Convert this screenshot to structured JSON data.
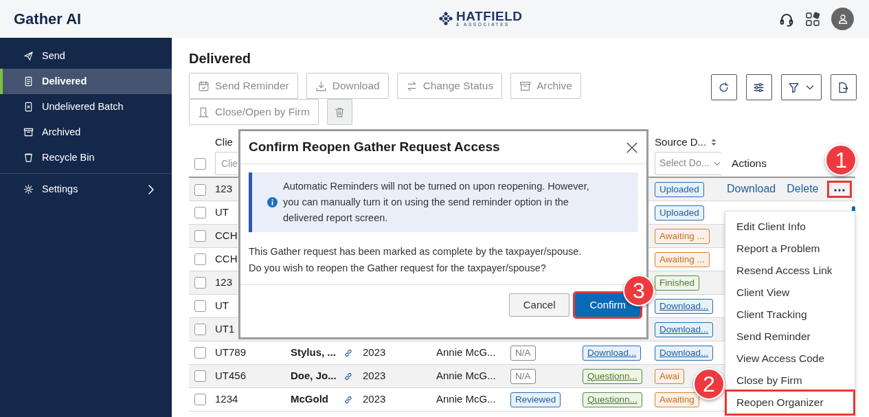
{
  "app": {
    "name": "Gather AI"
  },
  "brand": {
    "name": "HATFIELD",
    "tagline": "& ASSOCIATES"
  },
  "sidebar": {
    "items": [
      {
        "label": "Send",
        "selected": false
      },
      {
        "label": "Delivered",
        "selected": true
      },
      {
        "label": "Undelivered Batch",
        "selected": false
      },
      {
        "label": "Archived",
        "selected": false
      },
      {
        "label": "Recycle Bin",
        "selected": false
      }
    ],
    "settings": {
      "label": "Settings"
    }
  },
  "page": {
    "title": "Delivered"
  },
  "toolbar": {
    "buttons": [
      {
        "label": "Send Reminder",
        "disabled": true
      },
      {
        "label": "Download",
        "disabled": true
      },
      {
        "label": "Change Status",
        "disabled": true
      },
      {
        "label": "Archive",
        "disabled": true
      },
      {
        "label": "Close/Open by Firm",
        "disabled": true
      },
      {
        "disabled": true
      }
    ]
  },
  "table": {
    "select_all": {
      "checked": false
    },
    "header": {
      "column_1": {
        "label": "Clie",
        "filter_placeholder": "Clie"
      },
      "column_8": {
        "label": "Source D...",
        "filter_placeholder": "Select Do..."
      },
      "actions": {
        "label": "Actions"
      }
    },
    "rows": [
      {
        "checked": false,
        "column_1": "123",
        "column_8": {
          "text": "Uploaded",
          "kind": "uploaded"
        },
        "actions": {
          "links": [
            "Download",
            "Delete"
          ],
          "more": {
            "highlighted": true,
            "callout": "1"
          }
        }
      },
      {
        "checked": false,
        "column_1": "UT",
        "column_8": {
          "text": "Uploaded",
          "kind": "uploaded"
        }
      },
      {
        "checked": false,
        "column_1": "CCH",
        "column_8": {
          "text": "Awaiting ...",
          "kind": "awaiting"
        }
      },
      {
        "checked": false,
        "column_1": "CCH",
        "column_8": {
          "text": "Awaiting ...",
          "kind": "awaiting"
        }
      },
      {
        "checked": false,
        "column_1": "123",
        "column_8": {
          "text": "Finished",
          "kind": "finished"
        }
      },
      {
        "checked": false,
        "column_1": "UT",
        "column_8": {
          "text": "Download...",
          "kind": "download"
        }
      },
      {
        "checked": false,
        "column_1": "UT1",
        "column_8": {
          "text": "Download...",
          "kind": "download"
        }
      },
      {
        "checked": false,
        "column_1": "UT789",
        "column_2": "Stylus, ...",
        "link": true,
        "column_4": "2023",
        "column_5": "Annie McG...",
        "column_6": {
          "text": "N/A",
          "kind": "na"
        },
        "column_7": {
          "text": "Download...",
          "kind": "download"
        },
        "column_8": {
          "text": "Download...",
          "kind": "download"
        }
      },
      {
        "checked": false,
        "column_1": "UT456",
        "column_2": "Doe, Jo...",
        "link": true,
        "column_4": "2023",
        "column_5": "Annie McG...",
        "column_6": {
          "text": "N/A",
          "kind": "na"
        },
        "column_7": {
          "text": "Questionn...",
          "kind": "questionnaire"
        },
        "column_8": {
          "text": "Awai",
          "kind": "awaiting"
        }
      },
      {
        "checked": false,
        "column_1": "1234",
        "column_2": "McGold",
        "link": true,
        "column_4": "2023",
        "column_5": "Annie McG...",
        "column_6": {
          "text": "Reviewed",
          "kind": "reviewed"
        },
        "column_7": {
          "text": "Questionn...",
          "kind": "questionnaire"
        },
        "column_8": {
          "text": "Awaiting",
          "kind": "awaiting"
        }
      }
    ]
  },
  "menu": {
    "items": [
      {
        "label": "Edit Client Info",
        "highlighted": false
      },
      {
        "label": "Report a Problem",
        "highlighted": false
      },
      {
        "label": "Resend Access Link",
        "highlighted": false
      },
      {
        "label": "Client View",
        "highlighted": false
      },
      {
        "label": "Client Tracking",
        "highlighted": false
      },
      {
        "label": "Send Reminder",
        "highlighted": false
      },
      {
        "label": "View Access Code",
        "highlighted": false
      },
      {
        "label": "Close by Firm",
        "highlighted": false
      },
      {
        "label": "Reopen Organizer",
        "highlighted": true,
        "callout": "2"
      }
    ]
  },
  "modal": {
    "title": "Confirm Reopen Gather Request Access",
    "alert": {
      "text": "Automatic Reminders will not be turned on upon reopening. However, you can manually turn it on using the send reminder option in the delivered report screen."
    },
    "message_lines": [
      "This Gather request has been marked as complete by the taxpayer/spouse.",
      "Do you wish to reopen the Gather request for the taxpayer/spouse?"
    ],
    "buttons": [
      {
        "label": "Cancel",
        "kind": "secondary",
        "highlighted": false
      },
      {
        "label": "Confirm",
        "kind": "primary",
        "highlighted": true,
        "callout": "3"
      }
    ]
  }
}
